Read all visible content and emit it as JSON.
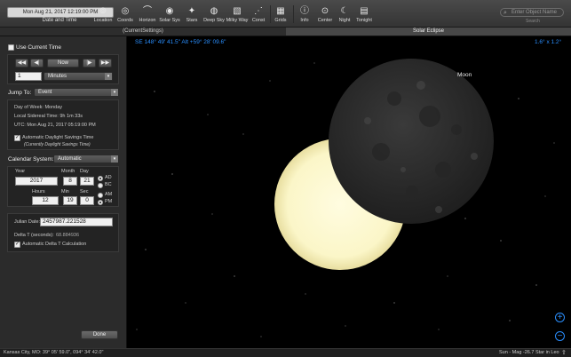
{
  "toolbar": {
    "datetime_value": "Mon Aug 21, 2017  12:19:00 PM",
    "datetime_label": "Date and Time",
    "buttons": [
      {
        "label": "Location",
        "icon": "location-pin-icon",
        "glyph": "⊚"
      },
      {
        "label": "Coords",
        "icon": "coordinates-icon",
        "glyph": "◎"
      },
      {
        "label": "Horizon",
        "icon": "horizon-icon",
        "glyph": "⌒"
      },
      {
        "label": "Solar Sys",
        "icon": "solar-system-icon",
        "glyph": "◉"
      },
      {
        "label": "Stars",
        "icon": "stars-icon",
        "glyph": "✦"
      },
      {
        "label": "Deep Sky",
        "icon": "deep-sky-icon",
        "glyph": "◍"
      },
      {
        "label": "Milky Way",
        "icon": "milky-way-icon",
        "glyph": "▧"
      },
      {
        "label": "Const",
        "icon": "constellation-icon",
        "glyph": "⋰"
      },
      {
        "label": "Grids",
        "icon": "grid-icon",
        "glyph": "▦"
      },
      {
        "label": "Info",
        "icon": "info-icon",
        "glyph": "ⓘ"
      },
      {
        "label": "Center",
        "icon": "center-icon",
        "glyph": "⊙"
      },
      {
        "label": "Night",
        "icon": "night-icon",
        "glyph": "☾"
      },
      {
        "label": "Tonight",
        "icon": "tonight-icon",
        "glyph": "▤"
      }
    ],
    "search_placeholder": "Enter Object Name",
    "search_label": "Search"
  },
  "tabs": [
    {
      "label": "(CurrentSettings)",
      "active": false
    },
    {
      "label": "Solar Eclipse",
      "active": true
    }
  ],
  "panel": {
    "use_current_time": "Use Current Time",
    "now_label": "Now",
    "step_value": "1",
    "step_unit": "Minutes",
    "jump_to_label": "Jump To:",
    "jump_to_value": "Event",
    "day_of_week": "Day of Week:  Monday",
    "sidereal_time": "Local Sidereal Time:  9h 1m 33s",
    "utc": "UTC:  Mon Aug 21, 2017  05:19:00 PM",
    "auto_dst": "Automatic Daylight Savings Time",
    "dst_note": "(Currently Daylight Savings Time)",
    "calendar_label": "Calendar System:",
    "calendar_value": "Automatic",
    "year_label": "Year",
    "month_label": "Month",
    "day_label": "Day",
    "year": "2017",
    "month": "8",
    "day": "21",
    "hours_label": "Hours",
    "min_label": "Min",
    "sec_label": "Sec",
    "hours": "12",
    "min": "19",
    "sec": "0",
    "ad": "AD",
    "bc": "BC",
    "am": "AM",
    "pm": "PM",
    "julian_label": "Julian Date:",
    "julian_value": "2457987.221528",
    "delta_t_label": "Delta T (seconds):",
    "delta_t_value": "68.884936",
    "auto_delta_t": "Automatic Delta T Calculation",
    "done": "Done"
  },
  "sky": {
    "coords": "SE 148° 49' 41.5\" Alt +59° 28' 09.6\"",
    "fov": "1.6° x  1.2°",
    "moon_label": "Moon",
    "sun_color": "#fffbd8",
    "moon_color": "#2e2e2e"
  },
  "status": {
    "location": "Kansas City, MO: 39° 05' 59.0\", 094° 34' 42.0\"",
    "object": "Sun - Mag -26.7 Star in Leo"
  }
}
